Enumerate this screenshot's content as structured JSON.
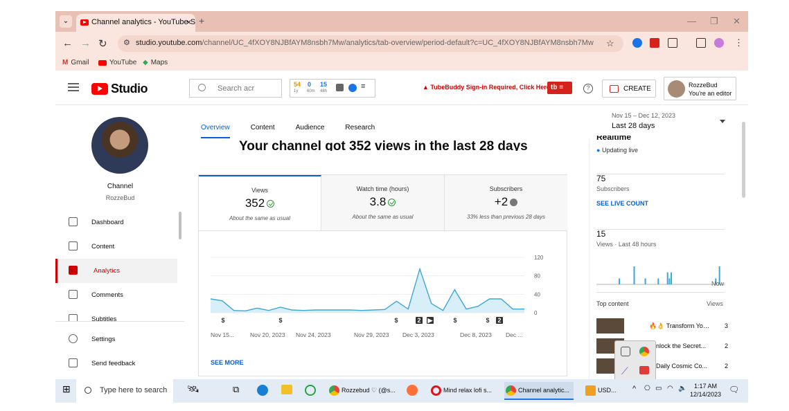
{
  "browser": {
    "tab_title": "Channel analytics - YouTube Studio",
    "tab_close": "×",
    "new_tab": "+",
    "url_host": "studio.youtube.com",
    "url_path": "/channel/UC_4fXOY8NJBfAYM8nsbh7Mw/analytics/tab-overview/period-default?c=UC_4fXOY8NJBfAYM8nsbh7Mw",
    "bookmarks": [
      "Gmail",
      "YouTube",
      "Maps"
    ]
  },
  "header": {
    "logo_text": "Studio",
    "search_placeholder": "Search acr",
    "tubebuddy_stats": {
      "a": "54",
      "b": "0",
      "c": "15",
      "a_sub": "1y",
      "b_sub": "60m",
      "c_sub": "48h"
    },
    "tubebuddy_warning": "TubeBuddy Sign-in Required, Click Here",
    "tb_badge": "tb",
    "create_label": "CREATE",
    "account_name": "RozzeBud",
    "account_role": "You're an editor"
  },
  "sidebar": {
    "channel_label": "Channel",
    "channel_name": "RozzeBud",
    "items": [
      {
        "label": "Dashboard",
        "icon": "dashboard-icon"
      },
      {
        "label": "Content",
        "icon": "content-icon"
      },
      {
        "label": "Analytics",
        "icon": "analytics-icon"
      },
      {
        "label": "Comments",
        "icon": "comments-icon"
      },
      {
        "label": "Subtitles",
        "icon": "subtitles-icon"
      }
    ],
    "settings": "Settings",
    "feedback": "Send feedback"
  },
  "main": {
    "tabs": [
      "Overview",
      "Content",
      "Audience",
      "Research"
    ],
    "headline": "Your channel got 352 views in the last 28 days",
    "stats": [
      {
        "label": "Views",
        "value": "352",
        "compare": "About the same as usual",
        "status": "ok"
      },
      {
        "label": "Watch time (hours)",
        "value": "3.8",
        "compare": "About the same as usual",
        "status": "ok"
      },
      {
        "label": "Subscribers",
        "value": "+2",
        "compare": "33% less than previous 28 days",
        "status": "down"
      }
    ],
    "see_more": "SEE MORE"
  },
  "chart_data": {
    "type": "area",
    "ylim": [
      0,
      120
    ],
    "y_ticks": [
      "120",
      "80",
      "40",
      "0"
    ],
    "x_tick_labels": [
      "Nov 15...",
      "Nov 20, 2023",
      "Nov 24, 2023",
      "Nov 29, 2023",
      "Dec 3, 2023",
      "Dec 8, 2023",
      "Dec ..."
    ],
    "series": [
      {
        "values": [
          30,
          26,
          5,
          4,
          10,
          5,
          12,
          6,
          5,
          6,
          6,
          6,
          6,
          5,
          6,
          7,
          25,
          8,
          95,
          20,
          5,
          50,
          8,
          14,
          30,
          30,
          8,
          8
        ]
      }
    ],
    "color": "#3ea6d4",
    "markers": [
      "$",
      "$",
      "$",
      "2",
      "▶",
      "$",
      "$",
      "2"
    ]
  },
  "datepicker": {
    "range": "Nov 15 – Dec 12, 2023",
    "label": "Last 28 days"
  },
  "realtime": {
    "title": "Realtime",
    "updating": "Updating live",
    "subscribers_value": "75",
    "subscribers_label": "Subscribers",
    "see_live": "SEE LIVE COUNT",
    "views48_value": "15",
    "views48_label": "Views · Last 48 hours",
    "now": "Now",
    "bars48": [
      0,
      0,
      0,
      0,
      0,
      0,
      0,
      0,
      0,
      0,
      0,
      0,
      1,
      0,
      0,
      0,
      0,
      0,
      0,
      0,
      3,
      0,
      0,
      0,
      0,
      0,
      1,
      0,
      0,
      0,
      0,
      0,
      0,
      1,
      0,
      0,
      0,
      0,
      2,
      1,
      2,
      0,
      0,
      0,
      0,
      0,
      0,
      0,
      0,
      0,
      0,
      0,
      0,
      0,
      0,
      0,
      0,
      0,
      0,
      0,
      0,
      0,
      0,
      0,
      1,
      0,
      3,
      0
    ],
    "top_content_label": "Top content",
    "views_col": "Views",
    "top_items": [
      {
        "title": "🔥👌 Transform Your Fit...",
        "views": "3"
      },
      {
        "title": "nlock the Secret...",
        "views": "2"
      },
      {
        "title": "Daily Cosmic Co...",
        "views": "2"
      }
    ]
  },
  "taskbar": {
    "search_placeholder": "Type here to search",
    "apps": [
      "Rozzebud ♡ (@s...",
      "Mind relax lofi s...",
      "Channel analytic...",
      "USD..."
    ],
    "time": "1:17 AM",
    "date": "12/14/2023"
  }
}
